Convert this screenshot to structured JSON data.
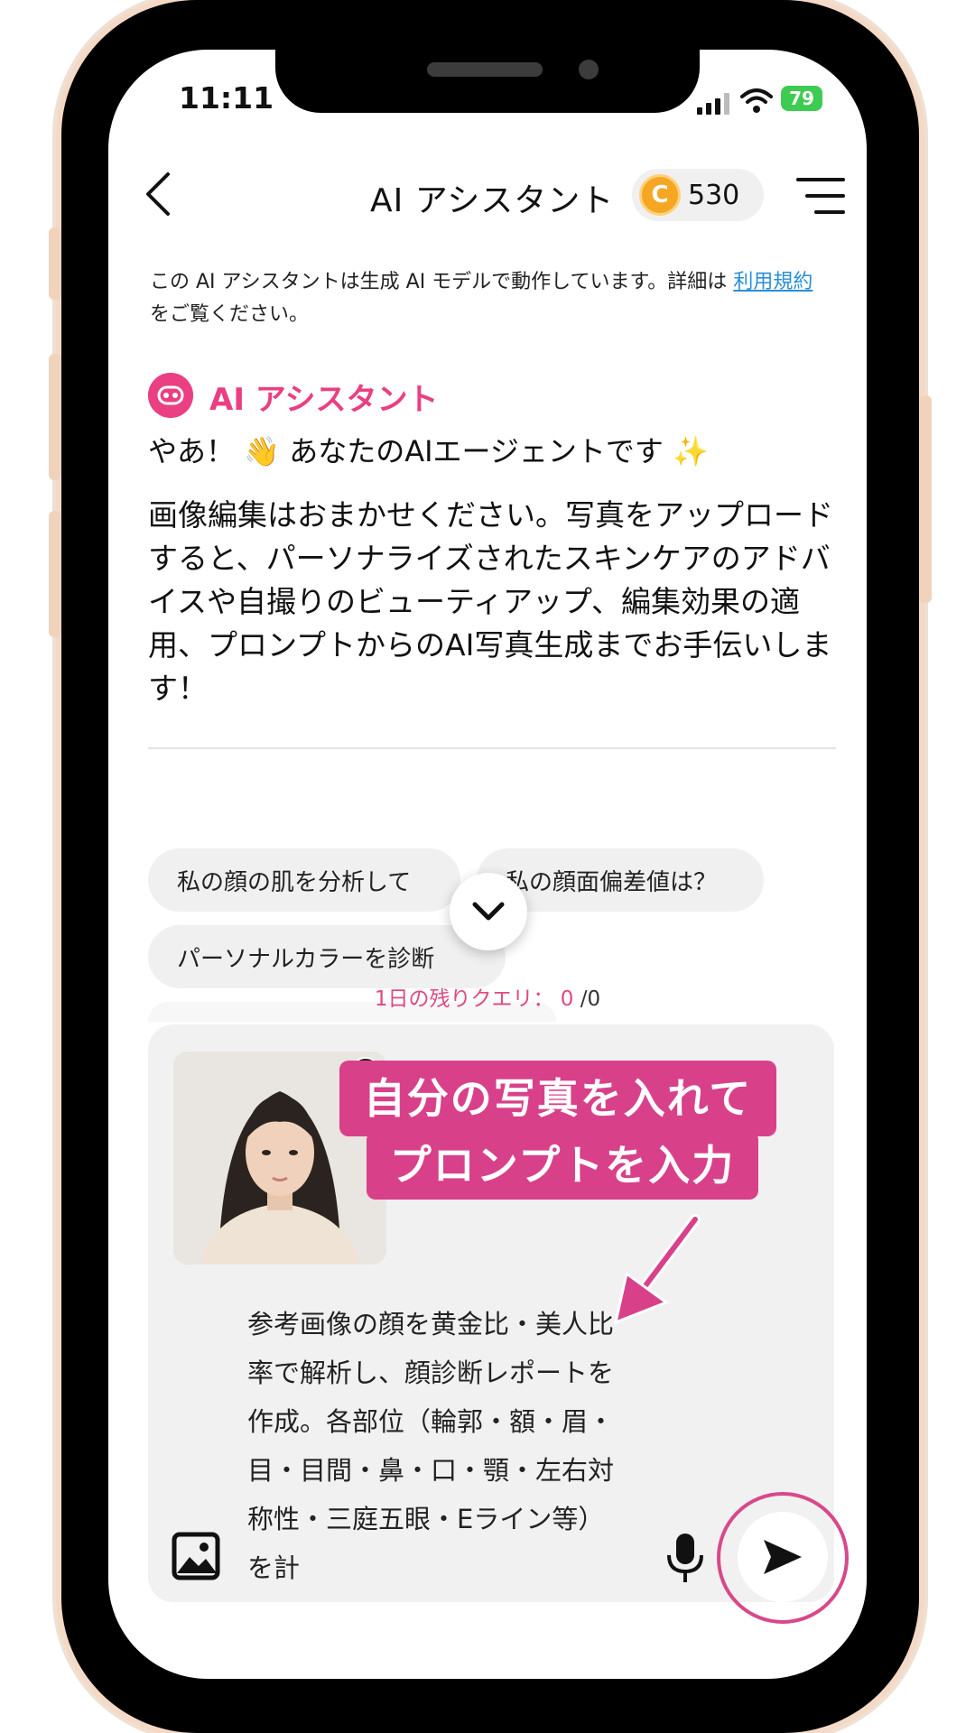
{
  "status_bar": {
    "time": "11:11",
    "battery": "79"
  },
  "header": {
    "title": "AI アシスタント",
    "coins": "530",
    "coin_symbol": "C"
  },
  "disclaimer": {
    "text": "この AI アシスタントは生成 AI モデルで動作しています。詳細は ",
    "link_text": "利用規約",
    "suffix": " をご覧ください。"
  },
  "assistant": {
    "name": "AI アシスタント",
    "greeting": "やあ！ 👋 あなたのAIエージェントです ✨",
    "intro": "画像編集はおまかせください。写真をアップロードすると、パーソナライズされたスキンケアのアドバイスや自撮りのビューティアップ、編集効果の適用、プロンプトからのAI写真生成までお手伝いします！"
  },
  "suggestions": [
    "私の顔の肌を分析して",
    "私の顔面偏差値は？",
    "パーソナルカラーを診断"
  ],
  "quota": {
    "label": "1日の残りクエリ：",
    "remaining": "0",
    "total": "/0"
  },
  "input": {
    "prompt": "参考画像の顔を黄金比・美人比率で解析し、顔診断レポートを作成。各部位（輪郭・額・眉・目・目間・鼻・口・顎・左右対称性・三庭五眼・Eライン等）を計"
  },
  "callout": {
    "line1": "自分の写真を入れて",
    "line2": "プロンプトを入力"
  },
  "colors": {
    "accent": "#ea3f82",
    "callout": "#d8418a",
    "link": "#2a8fd6"
  },
  "icons": [
    "back-icon",
    "coin-icon",
    "menu-icon",
    "robot-icon",
    "chevron-down-icon",
    "close-icon",
    "image-icon",
    "microphone-icon",
    "send-icon",
    "signal-icon",
    "wifi-icon",
    "battery-icon"
  ]
}
